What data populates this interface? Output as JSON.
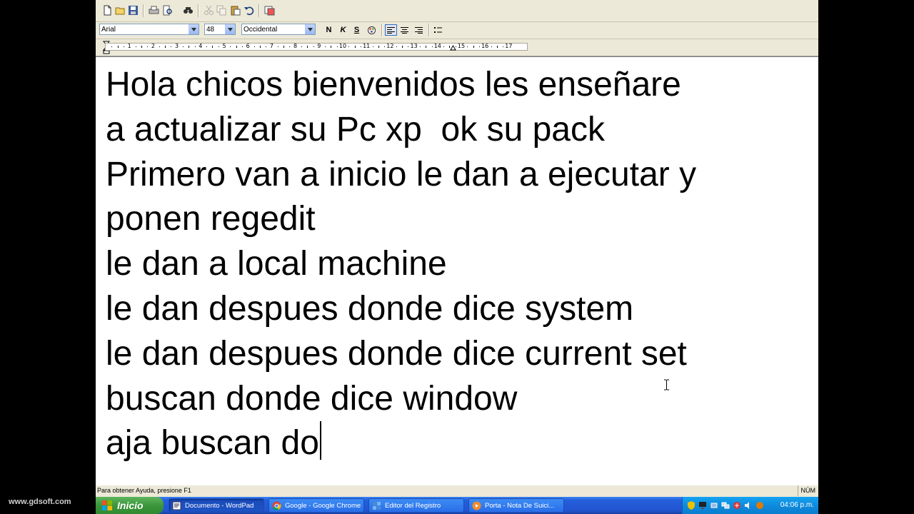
{
  "window": {
    "app": "WordPad"
  },
  "format_bar": {
    "font_name": "Arial",
    "font_size": "48",
    "script": "Occidental",
    "bold_label": "N",
    "italic_label": "K",
    "underline_label": "S"
  },
  "ruler": {
    "numbers": [
      "1",
      "2",
      "3",
      "4",
      "5",
      "6",
      "7",
      "8",
      "9",
      "10",
      "11",
      "12",
      "13",
      "14",
      "15",
      "16",
      "17"
    ]
  },
  "document": {
    "lines": [
      "Hola chicos bienvenidos les enseñare",
      "a actualizar su Pc xp  ok su pack",
      "Primero van a inicio le dan a ejecutar y",
      "ponen regedit",
      "le dan a local machine",
      "le dan despues donde dice system",
      "le dan despues donde dice current set",
      "buscan donde dice window",
      "aja buscan do"
    ]
  },
  "status_bar": {
    "help_text": "Para obtener Ayuda, presione F1",
    "num_lock": "NÚM"
  },
  "taskbar": {
    "start_label": "Inicio",
    "watermark": "www.gdsoft.com",
    "tasks": [
      {
        "label": "Documento - WordPad",
        "icon": "wordpad-icon",
        "active": true
      },
      {
        "label": "Google - Google Chrome",
        "icon": "chrome-icon",
        "active": false
      },
      {
        "label": "Editor del Registro",
        "icon": "regedit-icon",
        "active": false
      },
      {
        "label": "Porta - Nota De Suici...",
        "icon": "media-icon",
        "active": false
      }
    ],
    "clock": "04:06 p.m."
  },
  "colors": {
    "taskbar_blue": "#245edb",
    "start_green": "#3c963c",
    "tray_blue": "#0f8bdc"
  }
}
